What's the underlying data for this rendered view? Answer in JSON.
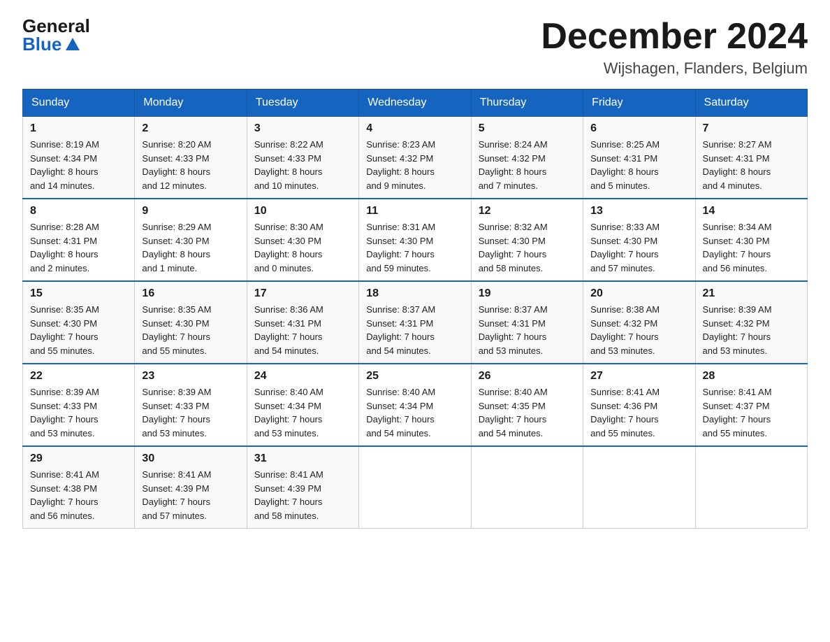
{
  "header": {
    "logo_general": "General",
    "logo_blue": "Blue",
    "month_title": "December 2024",
    "location": "Wijshagen, Flanders, Belgium"
  },
  "weekdays": [
    "Sunday",
    "Monday",
    "Tuesday",
    "Wednesday",
    "Thursday",
    "Friday",
    "Saturday"
  ],
  "weeks": [
    [
      {
        "day": "1",
        "sunrise": "8:19 AM",
        "sunset": "4:34 PM",
        "daylight": "8 hours and 14 minutes."
      },
      {
        "day": "2",
        "sunrise": "8:20 AM",
        "sunset": "4:33 PM",
        "daylight": "8 hours and 12 minutes."
      },
      {
        "day": "3",
        "sunrise": "8:22 AM",
        "sunset": "4:33 PM",
        "daylight": "8 hours and 10 minutes."
      },
      {
        "day": "4",
        "sunrise": "8:23 AM",
        "sunset": "4:32 PM",
        "daylight": "8 hours and 9 minutes."
      },
      {
        "day": "5",
        "sunrise": "8:24 AM",
        "sunset": "4:32 PM",
        "daylight": "8 hours and 7 minutes."
      },
      {
        "day": "6",
        "sunrise": "8:25 AM",
        "sunset": "4:31 PM",
        "daylight": "8 hours and 5 minutes."
      },
      {
        "day": "7",
        "sunrise": "8:27 AM",
        "sunset": "4:31 PM",
        "daylight": "8 hours and 4 minutes."
      }
    ],
    [
      {
        "day": "8",
        "sunrise": "8:28 AM",
        "sunset": "4:31 PM",
        "daylight": "8 hours and 2 minutes."
      },
      {
        "day": "9",
        "sunrise": "8:29 AM",
        "sunset": "4:30 PM",
        "daylight": "8 hours and 1 minute."
      },
      {
        "day": "10",
        "sunrise": "8:30 AM",
        "sunset": "4:30 PM",
        "daylight": "8 hours and 0 minutes."
      },
      {
        "day": "11",
        "sunrise": "8:31 AM",
        "sunset": "4:30 PM",
        "daylight": "7 hours and 59 minutes."
      },
      {
        "day": "12",
        "sunrise": "8:32 AM",
        "sunset": "4:30 PM",
        "daylight": "7 hours and 58 minutes."
      },
      {
        "day": "13",
        "sunrise": "8:33 AM",
        "sunset": "4:30 PM",
        "daylight": "7 hours and 57 minutes."
      },
      {
        "day": "14",
        "sunrise": "8:34 AM",
        "sunset": "4:30 PM",
        "daylight": "7 hours and 56 minutes."
      }
    ],
    [
      {
        "day": "15",
        "sunrise": "8:35 AM",
        "sunset": "4:30 PM",
        "daylight": "7 hours and 55 minutes."
      },
      {
        "day": "16",
        "sunrise": "8:35 AM",
        "sunset": "4:30 PM",
        "daylight": "7 hours and 55 minutes."
      },
      {
        "day": "17",
        "sunrise": "8:36 AM",
        "sunset": "4:31 PM",
        "daylight": "7 hours and 54 minutes."
      },
      {
        "day": "18",
        "sunrise": "8:37 AM",
        "sunset": "4:31 PM",
        "daylight": "7 hours and 54 minutes."
      },
      {
        "day": "19",
        "sunrise": "8:37 AM",
        "sunset": "4:31 PM",
        "daylight": "7 hours and 53 minutes."
      },
      {
        "day": "20",
        "sunrise": "8:38 AM",
        "sunset": "4:32 PM",
        "daylight": "7 hours and 53 minutes."
      },
      {
        "day": "21",
        "sunrise": "8:39 AM",
        "sunset": "4:32 PM",
        "daylight": "7 hours and 53 minutes."
      }
    ],
    [
      {
        "day": "22",
        "sunrise": "8:39 AM",
        "sunset": "4:33 PM",
        "daylight": "7 hours and 53 minutes."
      },
      {
        "day": "23",
        "sunrise": "8:39 AM",
        "sunset": "4:33 PM",
        "daylight": "7 hours and 53 minutes."
      },
      {
        "day": "24",
        "sunrise": "8:40 AM",
        "sunset": "4:34 PM",
        "daylight": "7 hours and 53 minutes."
      },
      {
        "day": "25",
        "sunrise": "8:40 AM",
        "sunset": "4:34 PM",
        "daylight": "7 hours and 54 minutes."
      },
      {
        "day": "26",
        "sunrise": "8:40 AM",
        "sunset": "4:35 PM",
        "daylight": "7 hours and 54 minutes."
      },
      {
        "day": "27",
        "sunrise": "8:41 AM",
        "sunset": "4:36 PM",
        "daylight": "7 hours and 55 minutes."
      },
      {
        "day": "28",
        "sunrise": "8:41 AM",
        "sunset": "4:37 PM",
        "daylight": "7 hours and 55 minutes."
      }
    ],
    [
      {
        "day": "29",
        "sunrise": "8:41 AM",
        "sunset": "4:38 PM",
        "daylight": "7 hours and 56 minutes."
      },
      {
        "day": "30",
        "sunrise": "8:41 AM",
        "sunset": "4:39 PM",
        "daylight": "7 hours and 57 minutes."
      },
      {
        "day": "31",
        "sunrise": "8:41 AM",
        "sunset": "4:39 PM",
        "daylight": "7 hours and 58 minutes."
      },
      null,
      null,
      null,
      null
    ]
  ],
  "labels": {
    "sunrise": "Sunrise:",
    "sunset": "Sunset:",
    "daylight": "Daylight:"
  }
}
